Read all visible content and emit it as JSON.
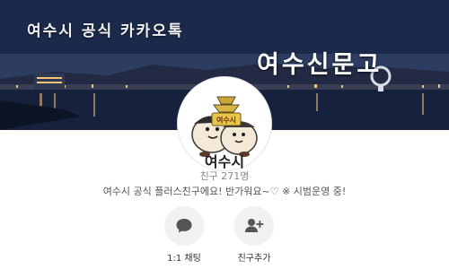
{
  "cover": {
    "title_top": "여수시 공식 카카오톡",
    "title_big": "여수신문고"
  },
  "profile": {
    "name": "여수시",
    "friend_count": "친구 271명",
    "status_message": "여수시 공식 플러스친구에요! 반가워요~♡ ※ 시범운영 중!",
    "mascot_sign": "여수시"
  },
  "actions": [
    {
      "label": "1:1 채팅",
      "icon": "chat-bubble-icon"
    },
    {
      "label": "친구추가",
      "icon": "add-friend-icon"
    }
  ],
  "colors": {
    "icon_gray": "#555555",
    "action_bg": "#f1f1f1",
    "mascot_sign": "#e8c64a"
  }
}
